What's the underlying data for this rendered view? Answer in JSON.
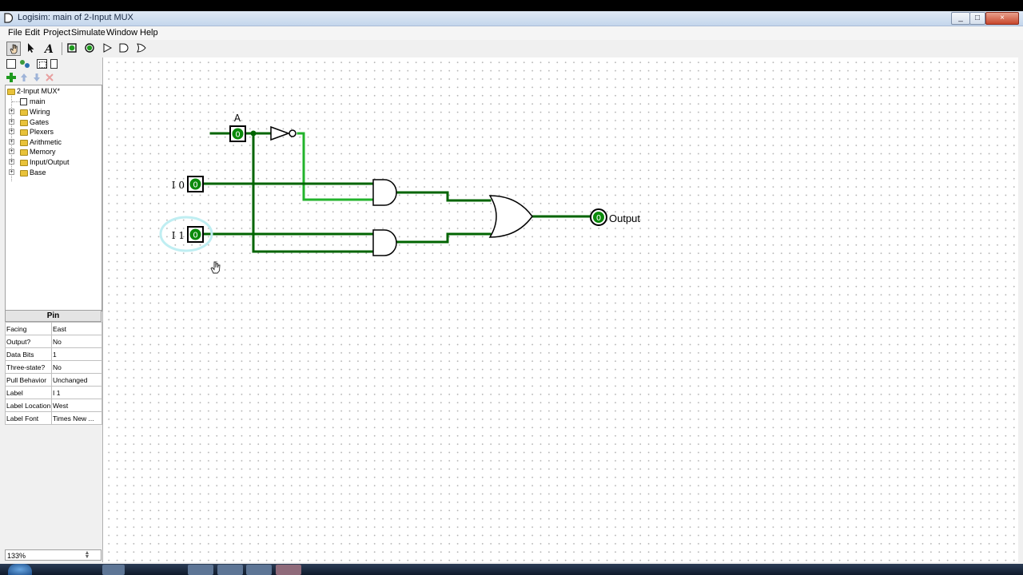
{
  "window": {
    "title": "Logisim: main of 2-Input MUX",
    "buttons": {
      "minimize": "_",
      "maximize": "□",
      "close": "×"
    }
  },
  "menu": [
    "File",
    "Edit",
    "Project",
    "Simulate",
    "Window",
    "Help"
  ],
  "toolbar": {
    "tools": [
      "hand-poke-icon",
      "arrow-select-icon",
      "text-tool-icon",
      "input-pin-icon",
      "output-pin-icon",
      "not-gate-icon",
      "and-gate-icon",
      "or-gate-icon"
    ],
    "text_tool_glyph": "A"
  },
  "explorer": {
    "project": "2-Input MUX*",
    "items": [
      {
        "label": "main",
        "type": "circuit"
      },
      {
        "label": "Wiring",
        "type": "library"
      },
      {
        "label": "Gates",
        "type": "library"
      },
      {
        "label": "Plexers",
        "type": "library"
      },
      {
        "label": "Arithmetic",
        "type": "library"
      },
      {
        "label": "Memory",
        "type": "library"
      },
      {
        "label": "Input/Output",
        "type": "library"
      },
      {
        "label": "Base",
        "type": "library"
      }
    ]
  },
  "attributes": {
    "title": "Pin",
    "rows": [
      {
        "key": "Facing",
        "value": "East"
      },
      {
        "key": "Output?",
        "value": "No"
      },
      {
        "key": "Data Bits",
        "value": "1"
      },
      {
        "key": "Three-state?",
        "value": "No"
      },
      {
        "key": "Pull Behavior",
        "value": "Unchanged"
      },
      {
        "key": "Label",
        "value": "I 1"
      },
      {
        "key": "Label Location",
        "value": "West"
      },
      {
        "key": "Label Font",
        "value": "Times New ..."
      }
    ]
  },
  "zoom": "133%",
  "circuit": {
    "pin_a_label": "A",
    "pin_i0_label": "I 0",
    "pin_i1_label": "I 1",
    "pin_a_value": "0",
    "pin_i0_value": "0",
    "pin_i1_value": "0",
    "output_label": "Output",
    "output_value": "0",
    "colors": {
      "wire_low": "#006400",
      "wire_high": "#22b32b",
      "pin_fill": "#0a8a0a"
    }
  }
}
